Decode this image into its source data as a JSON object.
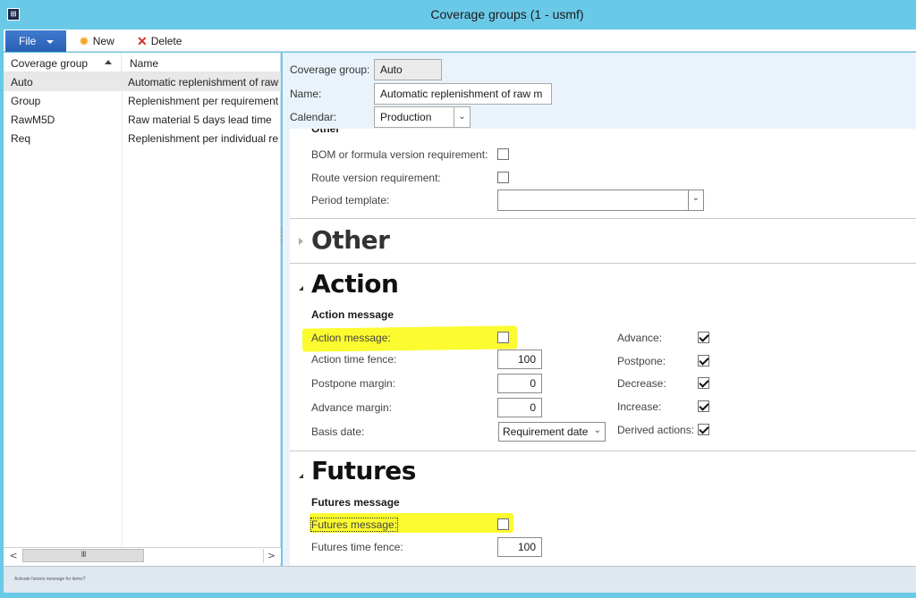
{
  "window": {
    "title": "Coverage groups (1 - usmf)",
    "app_icon": "dynamics-ax-icon"
  },
  "toolbar": {
    "file_label": "File",
    "new_label": "New",
    "delete_label": "Delete"
  },
  "grid": {
    "columns": [
      "Coverage group",
      "Name"
    ],
    "sort_column": "Coverage group",
    "sort_direction": "ascending",
    "rows": [
      {
        "group": "Auto",
        "name": "Automatic replenishment of raw materials",
        "selected": true
      },
      {
        "group": "Group",
        "name": "Replenishment per requirement",
        "selected": false
      },
      {
        "group": "RawM5D",
        "name": "Raw material 5 days lead time",
        "selected": false
      },
      {
        "group": "Req",
        "name": "Replenishment per individual requirement",
        "selected": false
      }
    ],
    "scroll_thumb_glyph": "III",
    "scroll_left": "<",
    "scroll_right": ">"
  },
  "header": {
    "coverage_group_label": "Coverage group:",
    "coverage_group_value": "Auto",
    "name_label": "Name:",
    "name_value": "Automatic replenishment of raw m",
    "calendar_label": "Calendar:",
    "calendar_value": "Production"
  },
  "other_group": {
    "heading_cut": "Other",
    "bom_label": "BOM or formula version requirement:",
    "bom_checked": false,
    "route_label": "Route version requirement:",
    "route_checked": false,
    "period_template_label": "Period template:",
    "period_template_value": ""
  },
  "sections": {
    "other_title": "Other",
    "other_expanded": false,
    "action_title": "Action",
    "action_expanded": true,
    "futures_title": "Futures",
    "futures_expanded": true
  },
  "action": {
    "group_title": "Action message",
    "action_message_label": "Action message:",
    "action_message_checked": false,
    "action_time_fence_label": "Action time fence:",
    "action_time_fence_value": "100",
    "postpone_margin_label": "Postpone margin:",
    "postpone_margin_value": "0",
    "advance_margin_label": "Advance margin:",
    "advance_margin_value": "0",
    "basis_date_label": "Basis date:",
    "basis_date_value": "Requirement date",
    "advance_label": "Advance:",
    "advance_checked": true,
    "postpone_label": "Postpone:",
    "postpone_checked": true,
    "decrease_label": "Decrease:",
    "decrease_checked": true,
    "increase_label": "Increase:",
    "increase_checked": true,
    "derived_label": "Derived actions:",
    "derived_checked": true
  },
  "futures": {
    "group_title": "Futures message",
    "futures_message_label": "Futures message:",
    "futures_message_checked": false,
    "futures_time_fence_label": "Futures time fence:",
    "futures_time_fence_value": "100"
  },
  "highlight_color": "#fbfb1e",
  "status": {
    "text": "Activate futures message for items?"
  }
}
